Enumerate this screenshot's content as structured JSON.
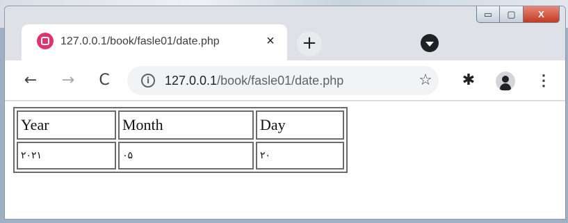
{
  "browser": {
    "tab": {
      "title": "127.0.0.1/book/fasle01/date.php",
      "favicon": "app-favicon-icon",
      "close_glyph": "×"
    },
    "new_tab_glyph": "+",
    "window_controls": {
      "minimize": "▭",
      "maximize": "▢",
      "close": "X"
    },
    "toolbar": {
      "back_glyph": "←",
      "forward_glyph": "→",
      "reload_glyph": "C",
      "info_glyph": "i",
      "url_host": "127.0.0.1",
      "url_path": "/book/fasle01/date.php",
      "star_glyph": "☆",
      "extensions_glyph": "✱",
      "menu_glyph": "⋮"
    }
  },
  "page": {
    "table": {
      "headers": [
        "Year",
        "Month",
        "Day"
      ],
      "rows": [
        [
          "۲۰۲۱",
          "۰۵",
          "۲۰"
        ]
      ]
    }
  },
  "colors": {
    "favicon": "#e0336b",
    "close_button": "#c23a22",
    "tabstrip": "#dee1e6"
  }
}
